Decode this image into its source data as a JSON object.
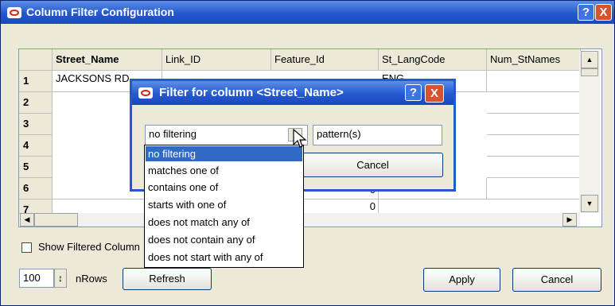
{
  "window": {
    "title": "Column Filter Configuration",
    "help_icon": "?",
    "close_icon": "X"
  },
  "table": {
    "columns": [
      "Street_Name",
      "Link_ID",
      "Feature_Id",
      "St_LangCode",
      "Num_StNames"
    ],
    "row_numbers": [
      "1",
      "2",
      "3",
      "4",
      "5",
      "6",
      "7"
    ],
    "first_row": [
      "JACKSONS RD",
      "",
      "",
      "ENG",
      ""
    ],
    "partial_values": [
      "0",
      "0",
      "0",
      "0"
    ]
  },
  "scroll": {
    "up": "▲",
    "down": "▼",
    "left": "◀",
    "right": "▶"
  },
  "filter_dialog": {
    "title": "Filter for column <Street_Name>",
    "help_icon": "?",
    "close_icon": "X",
    "filter_type_value": "no filtering",
    "dropdown_arrow": "▼",
    "pattern_value": "pattern(s)",
    "cancel_label": "Cancel",
    "options": [
      "no filtering",
      "matches one of",
      "contains one of",
      "starts with one of",
      "does not match any of",
      "does not contain any of",
      "does not start with any of"
    ],
    "selected_index": 0
  },
  "bottom": {
    "show_filtered_label": "Show Filtered Column",
    "show_filtered_checked": false,
    "rows_value": "100",
    "rows_label": "nRows",
    "spinner_icon": "↕",
    "refresh_label": "Refresh",
    "apply_label": "Apply",
    "cancel_label": "Cancel"
  },
  "colors": {
    "title_bar": "#2558d0",
    "selection": "#316ac5",
    "window_bg": "#ece9d8",
    "close_button": "#d9522f"
  }
}
